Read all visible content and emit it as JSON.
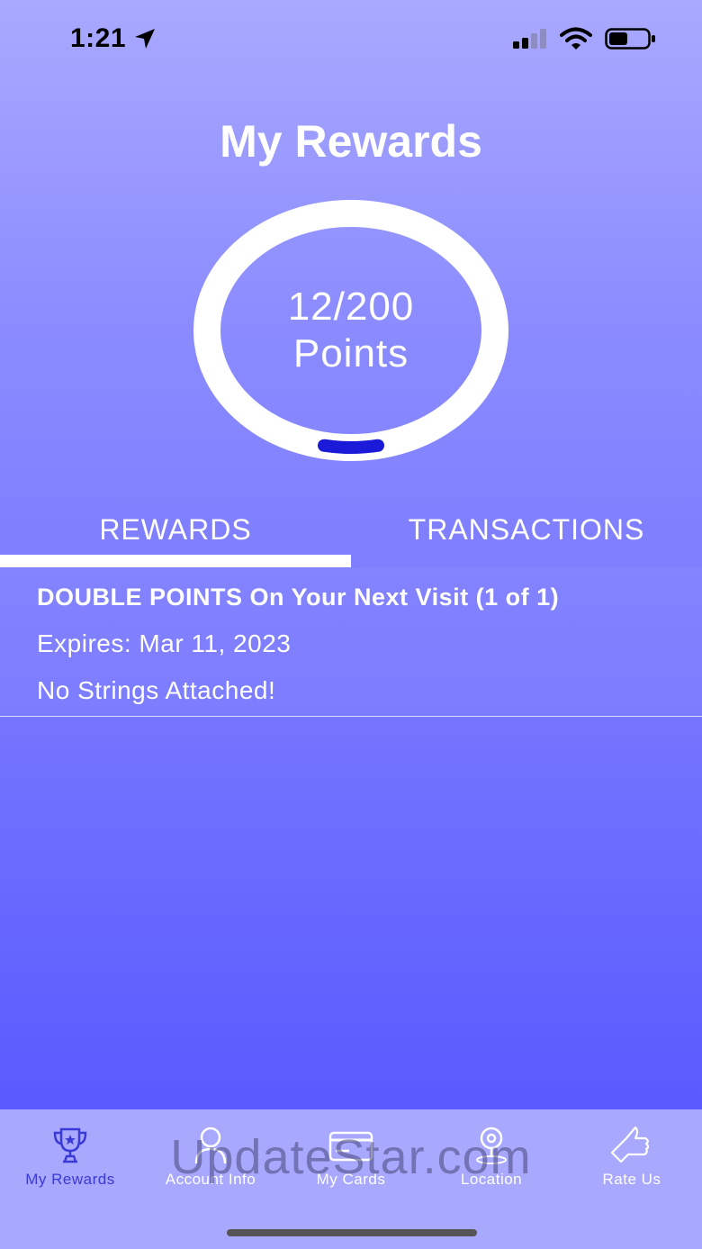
{
  "status_bar": {
    "time": "1:21",
    "location_icon": "location-arrow-icon",
    "signal_icon": "cellular-signal-icon",
    "wifi_icon": "wifi-icon",
    "battery_icon": "battery-icon"
  },
  "header": {
    "title": "My Rewards"
  },
  "points": {
    "value": "12/200",
    "label": "Points",
    "progress_fraction": 0.06
  },
  "tabs": {
    "rewards_label": "REWARDS",
    "transactions_label": "TRANSACTIONS",
    "active": "REWARDS"
  },
  "rewards": [
    {
      "title": "DOUBLE POINTS On Your Next Visit (1 of 1)",
      "expires": "Expires: Mar 11, 2023",
      "description": "No Strings Attached!"
    }
  ],
  "tab_bar": {
    "items": [
      {
        "label": "My Rewards",
        "icon": "trophy-icon",
        "active": true
      },
      {
        "label": "Account Info",
        "icon": "person-icon",
        "active": false
      },
      {
        "label": "My Cards",
        "icon": "card-icon",
        "active": false
      },
      {
        "label": "Location",
        "icon": "location-pin-icon",
        "active": false
      },
      {
        "label": "Rate Us",
        "icon": "thumbs-up-icon",
        "active": false
      }
    ]
  },
  "watermark": "UpdateStar.com",
  "colors": {
    "accent": "#3a3ad6",
    "progress": "#1a1ad8",
    "tab_bar_bg": "#a8a8ff"
  }
}
